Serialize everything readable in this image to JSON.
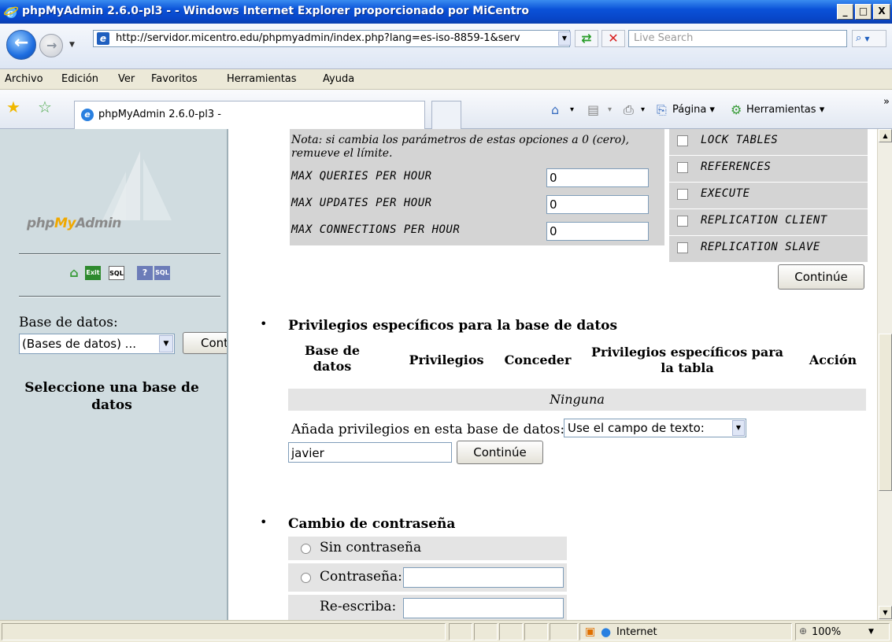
{
  "window": {
    "title": "phpMyAdmin 2.6.0-pl3 - - Windows Internet Explorer proporcionado por MiCentro",
    "minimize": "_",
    "maximize": "□",
    "close": "X"
  },
  "address": {
    "url": "http://servidor.micentro.edu/phpmyadmin/index.php?lang=es-iso-8859-1&serv",
    "search_placeholder": "Live Search"
  },
  "menu": [
    "Archivo",
    "Edición",
    "Ver",
    "Favoritos",
    "Herramientas",
    "Ayuda"
  ],
  "tab": {
    "title": "phpMyAdmin 2.6.0-pl3 -"
  },
  "commands": {
    "page": "Página",
    "tools": "Herramientas",
    "more": "»"
  },
  "sidebar": {
    "logo_php": "php",
    "logo_my": "My",
    "logo_admin": "Admin",
    "db_label": "Base de datos:",
    "db_select_value": "(Bases de datos) ...",
    "go_button": "Continúe",
    "message": "Seleccione una base de datos",
    "icons": [
      "home-icon",
      "exit-icon",
      "sql-icon",
      "help-icon",
      "sql-doc-icon"
    ]
  },
  "limits": {
    "note": "Nota: si cambia los parámetros de estas opciones a 0 (cero), remueve el límite.",
    "rows": [
      {
        "label": "MAX QUERIES PER HOUR",
        "value": "0"
      },
      {
        "label": "MAX UPDATES PER HOUR",
        "value": "0"
      },
      {
        "label": "MAX CONNECTIONS PER HOUR",
        "value": "0"
      }
    ]
  },
  "privileges": {
    "items": [
      "LOCK TABLES",
      "REFERENCES",
      "EXECUTE",
      "REPLICATION CLIENT",
      "REPLICATION SLAVE"
    ],
    "continue_button": "Continúe"
  },
  "db_privileges": {
    "title": "Privilegios específicos para la base de datos",
    "headers": [
      "Base de datos",
      "Privilegios",
      "Conceder",
      "Privilegios específicos para la tabla",
      "Acción"
    ],
    "empty_text": "Ninguna",
    "add_label": "Añada privilegios en esta base de datos:",
    "add_select_value": "Use el campo de texto:",
    "user_value": "javier",
    "continue_button": "Continúe"
  },
  "password": {
    "title": "Cambio de contraseña",
    "no_password": "Sin contraseña",
    "password_label": "Contraseña:",
    "retype_label": "Re-escriba:"
  },
  "status": {
    "zone": "Internet",
    "zoom": "100%"
  },
  "colors": {
    "title_bar": "#0a52d8",
    "sidebar_bg": "#d0dce0",
    "limits_bg": "#d4d4d4"
  }
}
